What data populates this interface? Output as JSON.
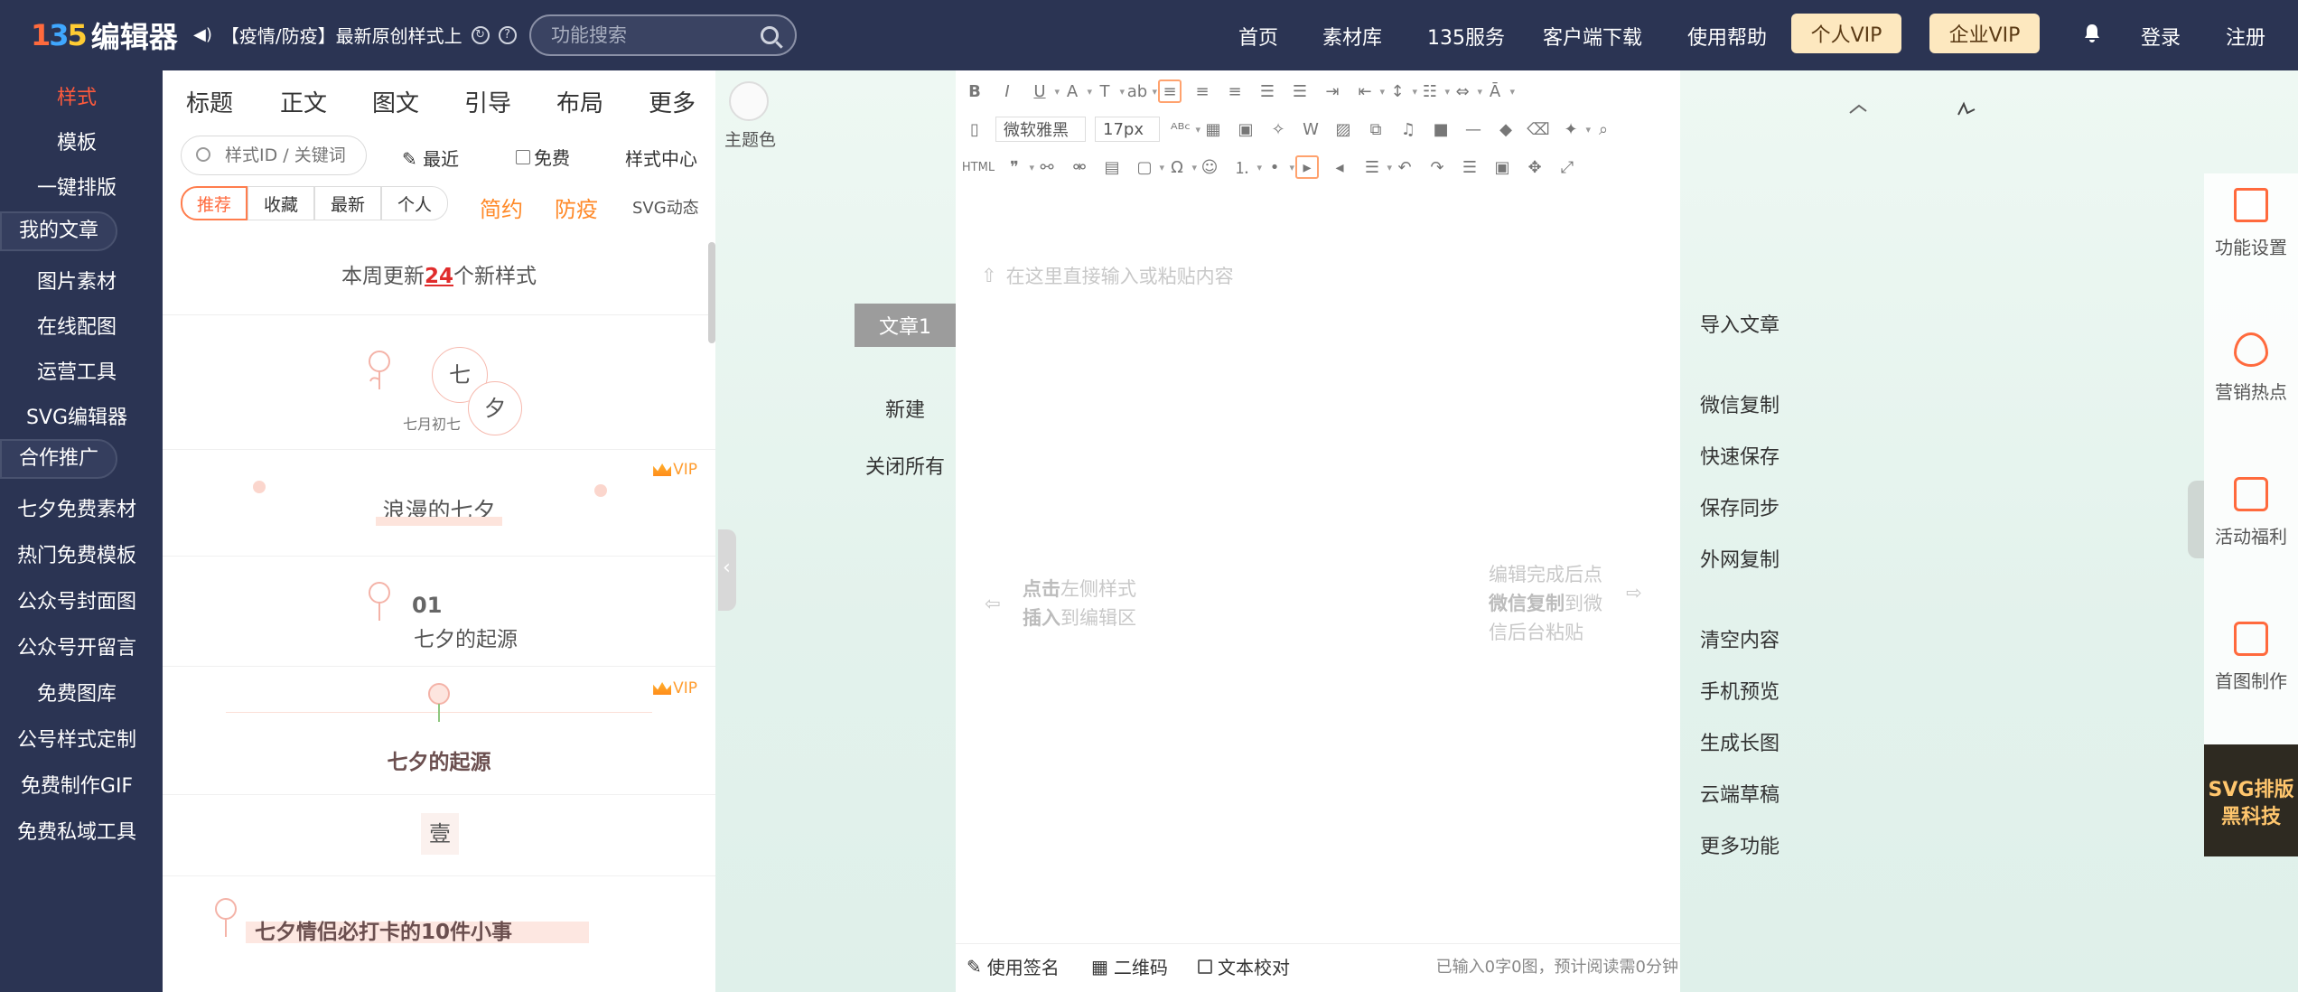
{
  "header": {
    "logo_mark": "135",
    "logo_text": "编辑器",
    "notice": "【疫情/防疫】最新原创样式上",
    "search_placeholder": "功能搜索",
    "nav": [
      "首页",
      "素材库",
      "135服务",
      "客户端下载",
      "使用帮助"
    ],
    "vip_personal": "个人VIP",
    "vip_enterprise": "企业VIP",
    "login": "登录",
    "register": "注册"
  },
  "sidebar": {
    "items": [
      "样式",
      "模板",
      "一键排版",
      "我的文章",
      "图片素材",
      "在线配图",
      "运营工具",
      "SVG编辑器",
      "合作推广",
      "七夕免费素材",
      "热门免费模板",
      "公众号封面图",
      "公众号开留言",
      "免费图库",
      "公号样式定制",
      "免费制作GIF",
      "免费私域工具"
    ]
  },
  "style_panel": {
    "tabs": [
      "标题",
      "正文",
      "图文",
      "引导",
      "布局",
      "更多"
    ],
    "theme_label": "主题色",
    "search_placeholder": "样式ID / 关键词",
    "recent": "最近",
    "free": "免费",
    "style_center": "样式中心",
    "segments": [
      "推荐",
      "收藏",
      "最新",
      "个人"
    ],
    "tag_simple": "简约",
    "tag_epidemic": "防疫",
    "tag_svg": "SVG动态",
    "weekly_prefix": "本周更新",
    "weekly_count": "24",
    "weekly_suffix": "个新样式",
    "cards": {
      "c1_big": "七",
      "c1_big2": "夕",
      "c1_date": "七月初七",
      "c2_title": "浪漫的七夕",
      "c2_vip": "VIP",
      "c3_num": "01",
      "c3_title": "七夕的起源",
      "c4_title": "七夕的起源",
      "c4_vip": "VIP",
      "c5_title": "壹",
      "c6_title": "七夕情侣必打卡的10件小事"
    }
  },
  "doc": {
    "tab": "文章1",
    "new": "新建",
    "close_all": "关闭所有"
  },
  "editor": {
    "font_family": "微软雅黑",
    "font_size": "17px",
    "html_label": "HTML",
    "placeholder": "在这里直接输入或粘贴内容",
    "hint_left_bold1": "点击",
    "hint_left_1": "左侧样式",
    "hint_left_bold2": "插入",
    "hint_left_2": "到编辑区",
    "hint_right_1": "编辑完成后点",
    "hint_right_bold": "微信复制",
    "hint_right_2": "到微",
    "hint_right_3": "信后台粘贴",
    "footer_signature": "使用签名",
    "footer_qrcode": "二维码",
    "footer_proof": "文本校对",
    "footer_status": "已输入0字0图，预计阅读需0分钟"
  },
  "actions": [
    "导入文章",
    "微信复制",
    "快速保存",
    "保存同步",
    "外网复制",
    "清空内容",
    "手机预览",
    "生成长图",
    "云端草稿",
    "更多功能"
  ],
  "feature_bar": {
    "items": [
      "功能设置",
      "营销热点",
      "活动福利",
      "首图制作"
    ],
    "promo_line1": "SVG排版",
    "promo_line2": "黑科技"
  },
  "colors": {
    "topbar": "#2b3453",
    "accent": "#ff6a3d",
    "vip_bg": "#fde8bf"
  }
}
